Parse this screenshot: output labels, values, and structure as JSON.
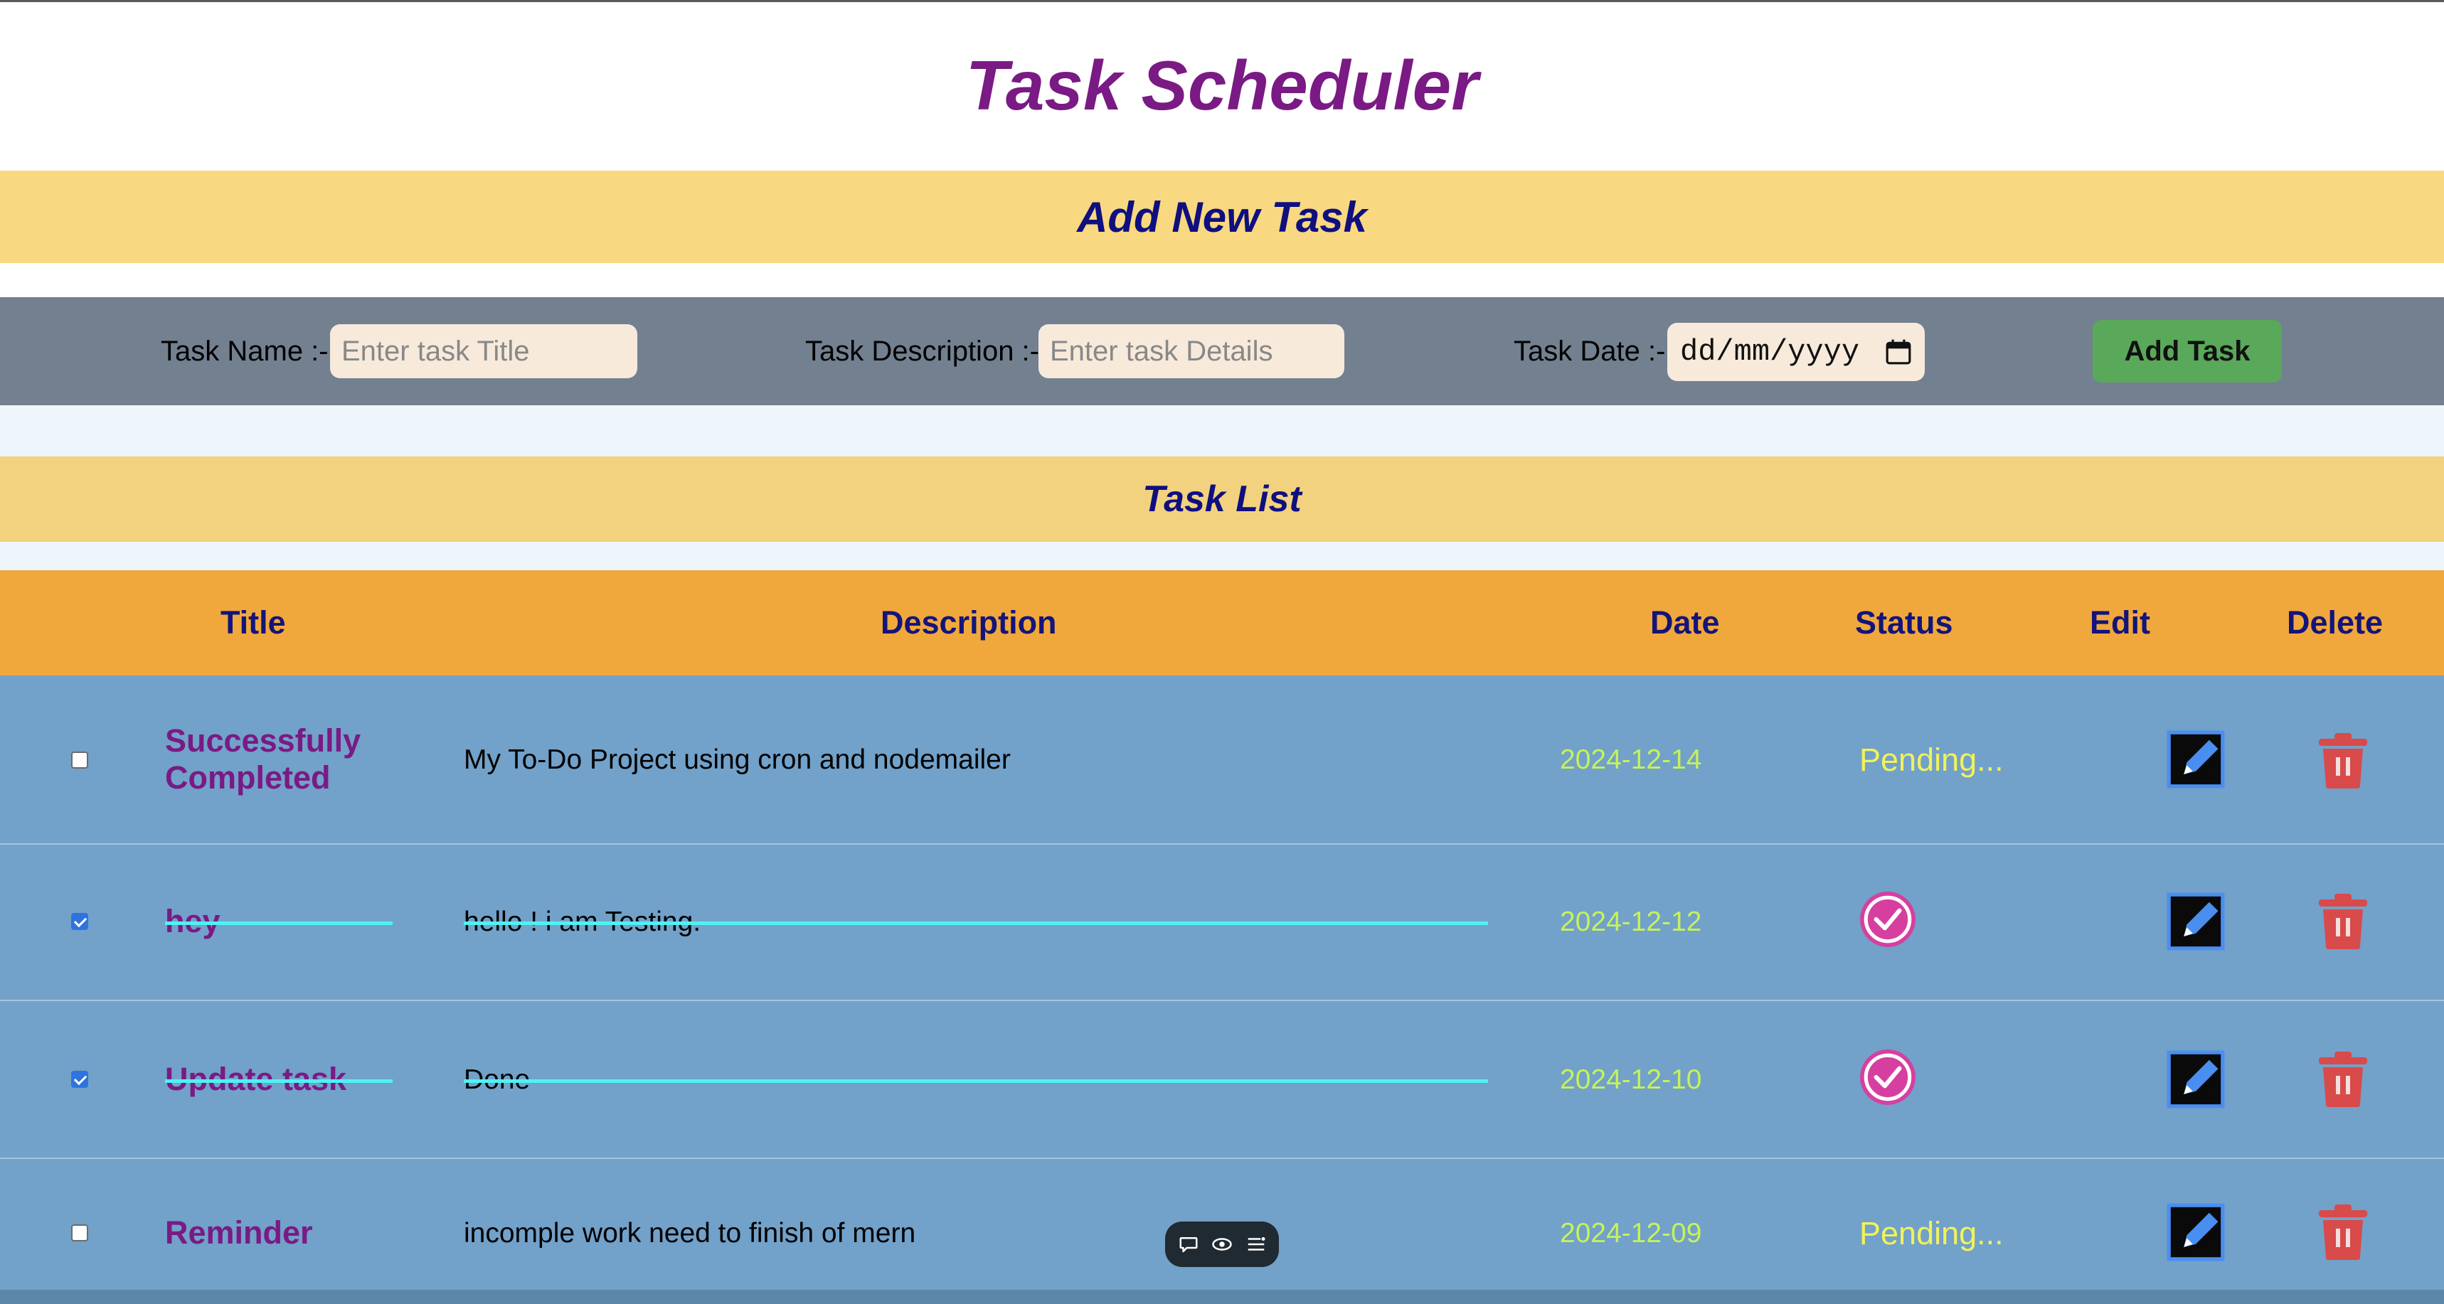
{
  "page": {
    "title": "Task Scheduler"
  },
  "add_section": {
    "heading": "Add New Task"
  },
  "form": {
    "name_label": "Task Name :-",
    "name_placeholder": "Enter task Title",
    "description_label": "Task Description :-",
    "description_placeholder": "Enter task Details",
    "date_label": "Task Date :-",
    "date_placeholder": "dd/mm/yyyy",
    "submit_label": "Add Task"
  },
  "list_section": {
    "heading": "Task List"
  },
  "table": {
    "columns": [
      "Title",
      "Description",
      "Date",
      "Status",
      "Edit",
      "Delete"
    ],
    "rows": [
      {
        "checked": false,
        "title_line1": "Successfully",
        "title_line2": "Completed",
        "description": "My To-Do Project using cron and nodemailer",
        "date": "2024-12-14",
        "status": "Pending...",
        "completed": false
      },
      {
        "checked": true,
        "title_line1": "hey",
        "title_line2": "",
        "description": "hello ! i am Testing.",
        "date": "2024-12-12",
        "status": "completed-check-icon",
        "completed": true
      },
      {
        "checked": true,
        "title_line1": "Update task",
        "title_line2": "",
        "description": "Done",
        "date": "2024-12-10",
        "status": "completed-check-icon",
        "completed": true
      },
      {
        "checked": false,
        "title_line1": "Reminder",
        "title_line2": "",
        "description": "incomple work need to finish of mern",
        "date": "2024-12-09",
        "status": "Pending...",
        "completed": false
      }
    ]
  },
  "colors": {
    "page_title": "#7a1a84",
    "section_band": "#f8d880",
    "form_bar": "#738090",
    "table_header": "#f0a83c",
    "row_bg": "#72a1c9",
    "add_button": "#5aa85a",
    "date_text": "#c6f25a",
    "pending_text": "#f1f25a",
    "strike_line": "#4ef2f2",
    "delete_icon": "#d94a4a"
  },
  "icons": {
    "status_done": "check-circle-icon",
    "edit": "edit-square-icon",
    "delete": "trash-icon",
    "calendar": "calendar-icon",
    "toolbar": [
      "comment-icon",
      "eye-icon",
      "list-icon"
    ]
  }
}
